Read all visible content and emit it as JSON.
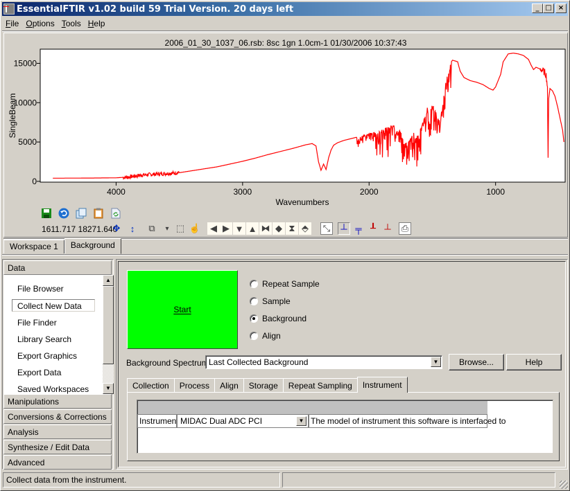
{
  "window": {
    "title": "EssentialFTIR v1.02 build 59 Trial Version. 20 days left",
    "controls": {
      "minimize": "_",
      "maximize": "□",
      "close": "×"
    }
  },
  "menu": [
    {
      "label": "File",
      "accel": "F"
    },
    {
      "label": "Options",
      "accel": "O"
    },
    {
      "label": "Tools",
      "accel": "T"
    },
    {
      "label": "Help",
      "accel": "H"
    }
  ],
  "chart_data": {
    "type": "line",
    "title": "2006_01_30_1037_06.rsb: 8sc 1gn 1.0cm-1 01/30/2006 10:37:43",
    "xlabel": "Wavenumbers",
    "ylabel": "SingleBeam",
    "xlim": [
      4600,
      450
    ],
    "ylim": [
      -100,
      16800
    ],
    "x_reversed": true,
    "xticks": [
      4000,
      3000,
      2000,
      1000
    ],
    "yticks": [
      0,
      5000,
      10000,
      15000
    ],
    "grid": false,
    "series": [
      {
        "name": "SingleBeam",
        "color": "#ff0000",
        "points": [
          [
            4500,
            400
          ],
          [
            4200,
            420
          ],
          [
            4000,
            450
          ],
          [
            3900,
            550
          ],
          [
            3800,
            800
          ],
          [
            3700,
            900
          ],
          [
            3600,
            1000
          ],
          [
            3500,
            1100
          ],
          [
            3400,
            1350
          ],
          [
            3300,
            1600
          ],
          [
            3200,
            1850
          ],
          [
            3100,
            2200
          ],
          [
            3000,
            2550
          ],
          [
            2900,
            2950
          ],
          [
            2800,
            3400
          ],
          [
            2700,
            3800
          ],
          [
            2600,
            4200
          ],
          [
            2500,
            4650
          ],
          [
            2450,
            4800
          ],
          [
            2420,
            4500
          ],
          [
            2400,
            2500
          ],
          [
            2380,
            1400
          ],
          [
            2360,
            2200
          ],
          [
            2340,
            1500
          ],
          [
            2320,
            3000
          ],
          [
            2300,
            4000
          ],
          [
            2280,
            4600
          ],
          [
            2250,
            4900
          ],
          [
            2200,
            5200
          ],
          [
            2100,
            5600
          ],
          [
            2000,
            6100
          ],
          [
            1950,
            6300
          ],
          [
            1900,
            6600
          ],
          [
            1850,
            6900
          ],
          [
            1800,
            7200
          ],
          [
            1750,
            6300
          ],
          [
            1720,
            5200
          ],
          [
            1700,
            4800
          ],
          [
            1680,
            5200
          ],
          [
            1650,
            6200
          ],
          [
            1620,
            5800
          ],
          [
            1600,
            6600
          ],
          [
            1580,
            7400
          ],
          [
            1560,
            8200
          ],
          [
            1540,
            9500
          ],
          [
            1520,
            8600
          ],
          [
            1500,
            10000
          ],
          [
            1480,
            9200
          ],
          [
            1460,
            8200
          ],
          [
            1440,
            7600
          ],
          [
            1420,
            9800
          ],
          [
            1400,
            12200
          ],
          [
            1380,
            13600
          ],
          [
            1360,
            15000
          ],
          [
            1340,
            15400
          ],
          [
            1320,
            15300
          ],
          [
            1300,
            15200
          ],
          [
            1280,
            14000
          ],
          [
            1250,
            13200
          ],
          [
            1200,
            12800
          ],
          [
            1150,
            12600
          ],
          [
            1100,
            12300
          ],
          [
            1050,
            11800
          ],
          [
            1020,
            11600
          ],
          [
            1000,
            12000
          ],
          [
            960,
            13600
          ],
          [
            940,
            15200
          ],
          [
            900,
            16200
          ],
          [
            860,
            16300
          ],
          [
            820,
            16200
          ],
          [
            780,
            16000
          ],
          [
            740,
            15500
          ],
          [
            720,
            14800
          ],
          [
            700,
            14200
          ],
          [
            680,
            14500
          ],
          [
            650,
            14300
          ],
          [
            620,
            14000
          ],
          [
            600,
            13500
          ],
          [
            590,
            12000
          ],
          [
            585,
            3000
          ],
          [
            580,
            10500
          ],
          [
            570,
            11800
          ],
          [
            550,
            11500
          ],
          [
            530,
            10800
          ],
          [
            510,
            9500
          ],
          [
            490,
            8000
          ],
          [
            470,
            6500
          ],
          [
            460,
            5000
          ]
        ]
      }
    ]
  },
  "readout": {
    "x": "1611.717",
    "y": "18271.640"
  },
  "toolbar_top": [
    "save-icon",
    "undo-icon",
    "copy-icon",
    "paste-icon",
    "refresh-document-icon"
  ],
  "toolbar_bottom": [
    "pan-icon",
    "vertical-pan-icon",
    "zoom-window-icon",
    "dropdown-arrow-icon",
    "select-rect-icon",
    "hand-icon",
    "scroll-left-icon",
    "scroll-right-icon",
    "scroll-down-icon",
    "scroll-up-icon",
    "expand-horizontal-icon",
    "compress-horizontal-icon",
    "expand-vertical-icon",
    "compress-vertical-icon",
    "autoscale-icon",
    "overlay-icon",
    "stack-icon",
    "offset-icon",
    "single-icon",
    "print-icon"
  ],
  "workspace_tabs": [
    {
      "label": "Workspace 1",
      "active": false
    },
    {
      "label": "Background",
      "active": true
    }
  ],
  "sidebar": {
    "sections": [
      "Data",
      "Manipulations",
      "Conversions & Corrections",
      "Analysis",
      "Synthesize / Edit Data",
      "Advanced"
    ],
    "data_items": [
      "File Browser",
      "Collect New Data",
      "File Finder",
      "Library Search",
      "Export Graphics",
      "Export Data",
      "Saved Workspaces"
    ],
    "selected_item": "Collect New Data"
  },
  "collect": {
    "start_label": "Start",
    "start_color": "#00ff00",
    "modes": [
      {
        "label": "Repeat Sample",
        "checked": false
      },
      {
        "label": "Sample",
        "checked": false
      },
      {
        "label": "Background",
        "checked": true
      },
      {
        "label": "Align",
        "checked": false
      }
    ],
    "background_spectrum_label": "Background Spectrum:",
    "background_spectrum_value": "Last Collected Background",
    "browse_label": "Browse...",
    "help_label": "Help",
    "tabs": [
      {
        "label": "Collection",
        "active": false
      },
      {
        "label": "Process",
        "active": false
      },
      {
        "label": "Align",
        "active": false
      },
      {
        "label": "Storage",
        "active": false
      },
      {
        "label": "Repeat Sampling",
        "active": false
      },
      {
        "label": "Instrument",
        "active": true
      }
    ],
    "instrument_row": {
      "name": "Instrument",
      "value": "MIDAC Dual ADC PCI",
      "description": "The model of instrument this software is interfaced to"
    }
  },
  "status": {
    "message": "Collect data from the instrument.",
    "secondary": ""
  }
}
